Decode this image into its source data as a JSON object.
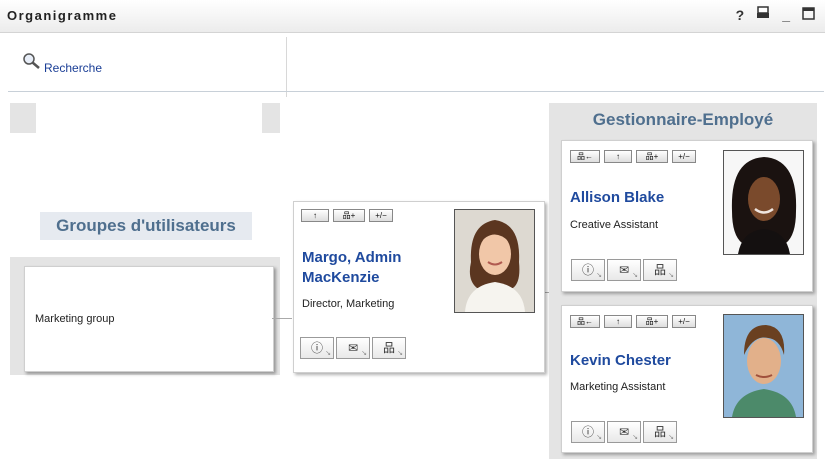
{
  "window": {
    "title": "Organigramme",
    "icons": [
      "help-icon",
      "print-icon",
      "minimize-icon",
      "maximize-icon"
    ],
    "icon_glyphs": {
      "help": "?",
      "print": "▤",
      "minimize": "_",
      "maximize": "▭"
    }
  },
  "search": {
    "label": "Recherche",
    "icon": "magnifier-icon"
  },
  "groups_panel": {
    "title": "Groupes d'utilisateurs",
    "groups": [
      {
        "name": "Marketing group"
      }
    ]
  },
  "focus_person": {
    "name": "Margo, Admin MacKenzie",
    "name_line1": "Margo, Admin",
    "name_line2": "MacKenzie",
    "title": "Director, Marketing",
    "top_buttons": [
      "↑",
      "品+",
      "+/−"
    ]
  },
  "manager_panel": {
    "title": "Gestionnaire-Employé",
    "employees": [
      {
        "name": "Allison Blake",
        "title": "Creative Assistant",
        "top_buttons": [
          "品←",
          "↑",
          "品+",
          "+/−"
        ]
      },
      {
        "name": "Kevin Chester",
        "title": "Marketing Assistant",
        "top_buttons": [
          "品←",
          "↑",
          "品+",
          "+/−"
        ]
      }
    ]
  },
  "card_buttons": {
    "info": "ⓘ",
    "email": "✉",
    "org": "品"
  },
  "colors": {
    "accent": "#1f4a9e",
    "section_title": "#4f6f8e",
    "panel_bg": "#e4e4e4"
  }
}
